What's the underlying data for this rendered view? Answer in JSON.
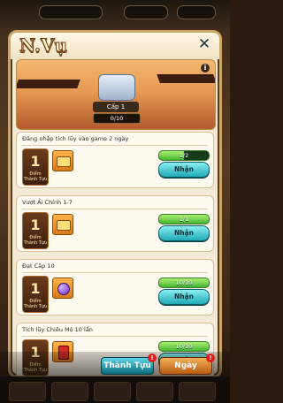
{
  "panel": {
    "title": "N.Vụ",
    "close_icon": "close-icon"
  },
  "banner": {
    "rank_label": "Cấp 1",
    "progress_text": "0/10",
    "progress_fraction": 0.0,
    "info_icon": "info-icon",
    "rank_emblem_icon": "silver-rank-emblem-icon"
  },
  "quests": [
    {
      "title": "Đăng nhập tích lũy vào game 2 ngày",
      "reward_count": "1",
      "reward_label": "Điểm Thành Tựu",
      "item_icon": "gold-ingot-icon",
      "progress_text": "1/2",
      "progress_fraction": 0.5,
      "claim_label": "Nhận"
    },
    {
      "title": "Vượt Ải Chính 1-7",
      "reward_count": "1",
      "reward_label": "Điểm Thành Tựu",
      "item_icon": "gold-ingot-icon",
      "progress_text": "1/1",
      "progress_fraction": 1.0,
      "claim_label": "Nhận"
    },
    {
      "title": "Đạt Cấp 10",
      "reward_count": "1",
      "reward_label": "Điểm Thành Tựu",
      "item_icon": "purple-gem-icon",
      "progress_text": "10/10",
      "progress_fraction": 1.0,
      "claim_label": "Nhận"
    },
    {
      "title": "Tích lũy Chiêu Mộ 10 lần",
      "reward_count": "1",
      "reward_label": "Điểm Thành Tựu",
      "item_icon": "red-scroll-icon",
      "progress_text": "10/10",
      "progress_fraction": 1.0,
      "claim_label": "Nhận"
    }
  ],
  "tabs": {
    "achievement_label": "Thành Tựu",
    "day_label": "Ngày",
    "badge_text": "!"
  }
}
